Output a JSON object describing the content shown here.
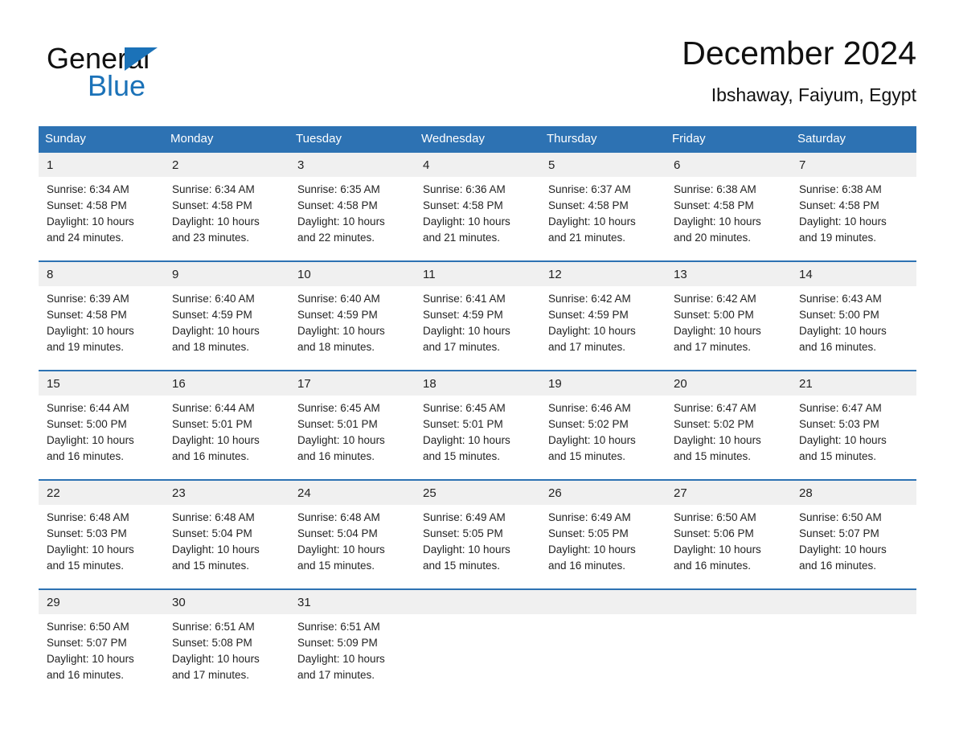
{
  "brand": {
    "name_part1": "General",
    "name_part2": "Blue",
    "triangle_color": "#1b72b8"
  },
  "header": {
    "title": "December 2024",
    "location": "Ibshaway, Faiyum, Egypt"
  },
  "theme": {
    "header_blue": "#2d72b3",
    "daynum_band": "#f0f0f0",
    "text": "#232323"
  },
  "weekdays": [
    "Sunday",
    "Monday",
    "Tuesday",
    "Wednesday",
    "Thursday",
    "Friday",
    "Saturday"
  ],
  "weeks": [
    {
      "days": [
        {
          "num": "1",
          "sunrise": "Sunrise: 6:34 AM",
          "sunset": "Sunset: 4:58 PM",
          "daylight1": "Daylight: 10 hours",
          "daylight2": "and 24 minutes."
        },
        {
          "num": "2",
          "sunrise": "Sunrise: 6:34 AM",
          "sunset": "Sunset: 4:58 PM",
          "daylight1": "Daylight: 10 hours",
          "daylight2": "and 23 minutes."
        },
        {
          "num": "3",
          "sunrise": "Sunrise: 6:35 AM",
          "sunset": "Sunset: 4:58 PM",
          "daylight1": "Daylight: 10 hours",
          "daylight2": "and 22 minutes."
        },
        {
          "num": "4",
          "sunrise": "Sunrise: 6:36 AM",
          "sunset": "Sunset: 4:58 PM",
          "daylight1": "Daylight: 10 hours",
          "daylight2": "and 21 minutes."
        },
        {
          "num": "5",
          "sunrise": "Sunrise: 6:37 AM",
          "sunset": "Sunset: 4:58 PM",
          "daylight1": "Daylight: 10 hours",
          "daylight2": "and 21 minutes."
        },
        {
          "num": "6",
          "sunrise": "Sunrise: 6:38 AM",
          "sunset": "Sunset: 4:58 PM",
          "daylight1": "Daylight: 10 hours",
          "daylight2": "and 20 minutes."
        },
        {
          "num": "7",
          "sunrise": "Sunrise: 6:38 AM",
          "sunset": "Sunset: 4:58 PM",
          "daylight1": "Daylight: 10 hours",
          "daylight2": "and 19 minutes."
        }
      ]
    },
    {
      "days": [
        {
          "num": "8",
          "sunrise": "Sunrise: 6:39 AM",
          "sunset": "Sunset: 4:58 PM",
          "daylight1": "Daylight: 10 hours",
          "daylight2": "and 19 minutes."
        },
        {
          "num": "9",
          "sunrise": "Sunrise: 6:40 AM",
          "sunset": "Sunset: 4:59 PM",
          "daylight1": "Daylight: 10 hours",
          "daylight2": "and 18 minutes."
        },
        {
          "num": "10",
          "sunrise": "Sunrise: 6:40 AM",
          "sunset": "Sunset: 4:59 PM",
          "daylight1": "Daylight: 10 hours",
          "daylight2": "and 18 minutes."
        },
        {
          "num": "11",
          "sunrise": "Sunrise: 6:41 AM",
          "sunset": "Sunset: 4:59 PM",
          "daylight1": "Daylight: 10 hours",
          "daylight2": "and 17 minutes."
        },
        {
          "num": "12",
          "sunrise": "Sunrise: 6:42 AM",
          "sunset": "Sunset: 4:59 PM",
          "daylight1": "Daylight: 10 hours",
          "daylight2": "and 17 minutes."
        },
        {
          "num": "13",
          "sunrise": "Sunrise: 6:42 AM",
          "sunset": "Sunset: 5:00 PM",
          "daylight1": "Daylight: 10 hours",
          "daylight2": "and 17 minutes."
        },
        {
          "num": "14",
          "sunrise": "Sunrise: 6:43 AM",
          "sunset": "Sunset: 5:00 PM",
          "daylight1": "Daylight: 10 hours",
          "daylight2": "and 16 minutes."
        }
      ]
    },
    {
      "days": [
        {
          "num": "15",
          "sunrise": "Sunrise: 6:44 AM",
          "sunset": "Sunset: 5:00 PM",
          "daylight1": "Daylight: 10 hours",
          "daylight2": "and 16 minutes."
        },
        {
          "num": "16",
          "sunrise": "Sunrise: 6:44 AM",
          "sunset": "Sunset: 5:01 PM",
          "daylight1": "Daylight: 10 hours",
          "daylight2": "and 16 minutes."
        },
        {
          "num": "17",
          "sunrise": "Sunrise: 6:45 AM",
          "sunset": "Sunset: 5:01 PM",
          "daylight1": "Daylight: 10 hours",
          "daylight2": "and 16 minutes."
        },
        {
          "num": "18",
          "sunrise": "Sunrise: 6:45 AM",
          "sunset": "Sunset: 5:01 PM",
          "daylight1": "Daylight: 10 hours",
          "daylight2": "and 15 minutes."
        },
        {
          "num": "19",
          "sunrise": "Sunrise: 6:46 AM",
          "sunset": "Sunset: 5:02 PM",
          "daylight1": "Daylight: 10 hours",
          "daylight2": "and 15 minutes."
        },
        {
          "num": "20",
          "sunrise": "Sunrise: 6:47 AM",
          "sunset": "Sunset: 5:02 PM",
          "daylight1": "Daylight: 10 hours",
          "daylight2": "and 15 minutes."
        },
        {
          "num": "21",
          "sunrise": "Sunrise: 6:47 AM",
          "sunset": "Sunset: 5:03 PM",
          "daylight1": "Daylight: 10 hours",
          "daylight2": "and 15 minutes."
        }
      ]
    },
    {
      "days": [
        {
          "num": "22",
          "sunrise": "Sunrise: 6:48 AM",
          "sunset": "Sunset: 5:03 PM",
          "daylight1": "Daylight: 10 hours",
          "daylight2": "and 15 minutes."
        },
        {
          "num": "23",
          "sunrise": "Sunrise: 6:48 AM",
          "sunset": "Sunset: 5:04 PM",
          "daylight1": "Daylight: 10 hours",
          "daylight2": "and 15 minutes."
        },
        {
          "num": "24",
          "sunrise": "Sunrise: 6:48 AM",
          "sunset": "Sunset: 5:04 PM",
          "daylight1": "Daylight: 10 hours",
          "daylight2": "and 15 minutes."
        },
        {
          "num": "25",
          "sunrise": "Sunrise: 6:49 AM",
          "sunset": "Sunset: 5:05 PM",
          "daylight1": "Daylight: 10 hours",
          "daylight2": "and 15 minutes."
        },
        {
          "num": "26",
          "sunrise": "Sunrise: 6:49 AM",
          "sunset": "Sunset: 5:05 PM",
          "daylight1": "Daylight: 10 hours",
          "daylight2": "and 16 minutes."
        },
        {
          "num": "27",
          "sunrise": "Sunrise: 6:50 AM",
          "sunset": "Sunset: 5:06 PM",
          "daylight1": "Daylight: 10 hours",
          "daylight2": "and 16 minutes."
        },
        {
          "num": "28",
          "sunrise": "Sunrise: 6:50 AM",
          "sunset": "Sunset: 5:07 PM",
          "daylight1": "Daylight: 10 hours",
          "daylight2": "and 16 minutes."
        }
      ]
    },
    {
      "days": [
        {
          "num": "29",
          "sunrise": "Sunrise: 6:50 AM",
          "sunset": "Sunset: 5:07 PM",
          "daylight1": "Daylight: 10 hours",
          "daylight2": "and 16 minutes."
        },
        {
          "num": "30",
          "sunrise": "Sunrise: 6:51 AM",
          "sunset": "Sunset: 5:08 PM",
          "daylight1": "Daylight: 10 hours",
          "daylight2": "and 17 minutes."
        },
        {
          "num": "31",
          "sunrise": "Sunrise: 6:51 AM",
          "sunset": "Sunset: 5:09 PM",
          "daylight1": "Daylight: 10 hours",
          "daylight2": "and 17 minutes."
        },
        {
          "num": "",
          "sunrise": "",
          "sunset": "",
          "daylight1": "",
          "daylight2": ""
        },
        {
          "num": "",
          "sunrise": "",
          "sunset": "",
          "daylight1": "",
          "daylight2": ""
        },
        {
          "num": "",
          "sunrise": "",
          "sunset": "",
          "daylight1": "",
          "daylight2": ""
        },
        {
          "num": "",
          "sunrise": "",
          "sunset": "",
          "daylight1": "",
          "daylight2": ""
        }
      ]
    }
  ]
}
